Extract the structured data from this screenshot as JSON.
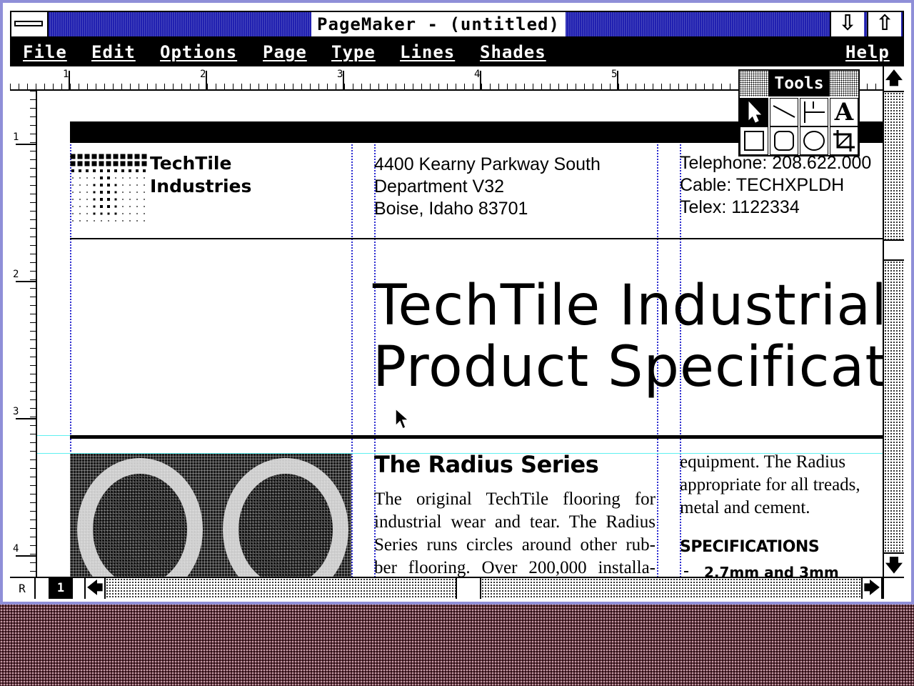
{
  "window": {
    "title": "PageMaker - (untitled)"
  },
  "menubar": {
    "items": [
      "File",
      "Edit",
      "Options",
      "Page",
      "Type",
      "Lines",
      "Shades"
    ],
    "help": "Help"
  },
  "rulers": {
    "horizontal_marks": [
      "1",
      "2",
      "3",
      "4",
      "5"
    ],
    "vertical_marks": [
      "1",
      "2",
      "3",
      "4"
    ]
  },
  "toolbox": {
    "title": "Tools",
    "tools": [
      "pointer-icon",
      "diagonal-line-icon",
      "perpendicular-line-icon",
      "text-tool-icon",
      "square-corner-box-icon",
      "rounded-box-icon",
      "oval-icon",
      "crop-icon"
    ],
    "selected": "pointer-icon"
  },
  "document": {
    "company_line1": "TechTile",
    "company_line2": "Industries",
    "address": [
      "4400 Kearny Parkway South",
      "Department V32",
      "Boise, Idaho  83701"
    ],
    "contact": [
      "Telephone:  208.622.000",
      "Cable: TECHXPLDH",
      "Telex: 1122334"
    ],
    "headline_line1": "TechTile Industrial",
    "headline_line2": "Product Specificatio",
    "section_title": "The Radius Series",
    "body_col2": [
      "The original TechTile flooring for",
      "industrial wear and tear.  The Radius",
      "Series runs circles around other rub-",
      "ber flooring.  Over 200,000 installa-"
    ],
    "body_col3": [
      "equipment.   The  Radius",
      "appropriate for all treads,",
      "metal and cement."
    ],
    "specs_title": "SPECIFICATIONS",
    "spec_item": "2.7mm and 3mm"
  },
  "statusbar": {
    "ruler_label": "R",
    "page_number": "1"
  },
  "colors": {
    "titlebar": "#2020b0",
    "frame": "#8f8fd8",
    "guide": "#2a2ad0",
    "margin_guide": "#5ff0f0",
    "desktop": "#6a2e3c"
  }
}
